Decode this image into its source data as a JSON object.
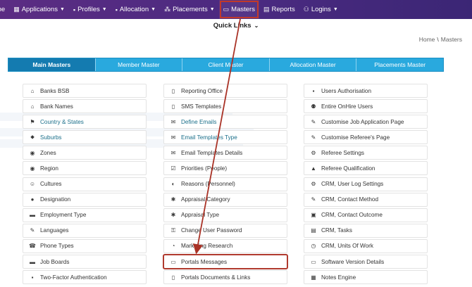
{
  "nav": {
    "items": [
      {
        "id": "home",
        "label": "me",
        "icon": "",
        "caret": false
      },
      {
        "id": "applications",
        "label": "Applications",
        "icon": "▦",
        "caret": true
      },
      {
        "id": "profiles",
        "label": "Profiles",
        "icon": "▪",
        "caret": true
      },
      {
        "id": "allocation",
        "label": "Allocation",
        "icon": "▪",
        "caret": true
      },
      {
        "id": "placements",
        "label": "Placements",
        "icon": "⁂",
        "caret": true
      },
      {
        "id": "masters",
        "label": "Masters",
        "icon": "▭",
        "caret": false,
        "active": true
      },
      {
        "id": "reports",
        "label": "Reports",
        "icon": "▤",
        "caret": false
      },
      {
        "id": "logins",
        "label": "Logins",
        "icon": "⚇",
        "caret": true
      }
    ]
  },
  "quick_links": {
    "label": "Quick Links"
  },
  "breadcrumb": {
    "home": "Home",
    "sep": "\\",
    "current": "Masters"
  },
  "tabs": [
    {
      "label": "Main Masters",
      "active": true
    },
    {
      "label": "Member Master"
    },
    {
      "label": "Client Master"
    },
    {
      "label": "Allocation Master"
    },
    {
      "label": "Placements Master"
    }
  ],
  "columns": [
    [
      {
        "label": "Banks BSB",
        "icon": "⌂",
        "icon_name": "bank-icon"
      },
      {
        "label": "Bank Names",
        "icon": "⌂",
        "icon_name": "bank-icon"
      },
      {
        "label": "Country & States",
        "icon": "⚑",
        "icon_name": "flag-icon",
        "teal": true
      },
      {
        "label": "Suburbs",
        "icon": "⬥",
        "icon_name": "map-marker-icon",
        "teal": true
      },
      {
        "label": "Zones",
        "icon": "◉",
        "icon_name": "globe-icon"
      },
      {
        "label": "Region",
        "icon": "◉",
        "icon_name": "globe-icon"
      },
      {
        "label": "Cultures",
        "icon": "☺",
        "icon_name": "smile-icon"
      },
      {
        "label": "Designation",
        "icon": "●",
        "icon_name": "user-icon"
      },
      {
        "label": "Employment Type",
        "icon": "▬",
        "icon_name": "briefcase-icon"
      },
      {
        "label": "Languages",
        "icon": "✎",
        "icon_name": "language-icon"
      },
      {
        "label": "Phone Types",
        "icon": "☎",
        "icon_name": "phone-icon"
      },
      {
        "label": "Job Boards",
        "icon": "▬",
        "icon_name": "briefcase-icon"
      },
      {
        "label": "Two-Factor Authentication",
        "icon": "▪",
        "icon_name": "lock-icon"
      }
    ],
    [
      {
        "label": "Reporting Office",
        "icon": "▯",
        "icon_name": "office-icon"
      },
      {
        "label": "SMS Templates",
        "icon": "▯",
        "icon_name": "sms-icon"
      },
      {
        "label": "Define Emails",
        "icon": "✉",
        "icon_name": "envelope-icon",
        "teal": true
      },
      {
        "label": "Email Templates Type",
        "icon": "✉",
        "icon_name": "envelope-icon",
        "teal": true
      },
      {
        "label": "Email Templates Details",
        "icon": "✉",
        "icon_name": "envelope-icon"
      },
      {
        "label": "Priorities (People)",
        "icon": "☑",
        "icon_name": "check-square-icon"
      },
      {
        "label": "Reasons (Personnel)",
        "icon": "◐",
        "icon_name": "ban-icon"
      },
      {
        "label": "Appraisal Category",
        "icon": "✱",
        "icon_name": "award-icon"
      },
      {
        "label": "Appraisal Type",
        "icon": "✱",
        "icon_name": "award-icon"
      },
      {
        "label": "Change User Password",
        "icon": "⚿",
        "icon_name": "unlock-icon"
      },
      {
        "label": "Marketing Research",
        "icon": "◔",
        "icon_name": "search-icon"
      },
      {
        "label": "Portals Messages",
        "icon": "▭",
        "icon_name": "monitor-icon",
        "highlight": true
      },
      {
        "label": "Portals Documents & Links",
        "icon": "▯",
        "icon_name": "document-icon"
      }
    ],
    [
      {
        "label": "Users Authorisation",
        "icon": "▪",
        "icon_name": "lock-icon"
      },
      {
        "label": "Entire OnHire Users",
        "icon": "⚉",
        "icon_name": "users-icon"
      },
      {
        "label": "Customise Job Application Page",
        "icon": "✎",
        "icon_name": "edit-icon"
      },
      {
        "label": "Customise Referee's Page",
        "icon": "✎",
        "icon_name": "edit-icon"
      },
      {
        "label": "Referee Settings",
        "icon": "⚙",
        "icon_name": "gears-icon"
      },
      {
        "label": "Referee Qualification",
        "icon": "▲",
        "icon_name": "graduation-cap-icon"
      },
      {
        "label": "CRM, User Log Settings",
        "icon": "⚙",
        "icon_name": "gear-icon"
      },
      {
        "label": "CRM, Contact Method",
        "icon": "✎",
        "icon_name": "pencil-icon"
      },
      {
        "label": "CRM, Contact Outcome",
        "icon": "▣",
        "icon_name": "window-icon"
      },
      {
        "label": "CRM, Tasks",
        "icon": "▤",
        "icon_name": "file-icon"
      },
      {
        "label": "CRM, Units Of Work",
        "icon": "◷",
        "icon_name": "clock-icon"
      },
      {
        "label": "Software Version Details",
        "icon": "▭",
        "icon_name": "monitor-icon"
      },
      {
        "label": "Notes Engine",
        "icon": "▦",
        "icon_name": "list-icon"
      }
    ]
  ]
}
